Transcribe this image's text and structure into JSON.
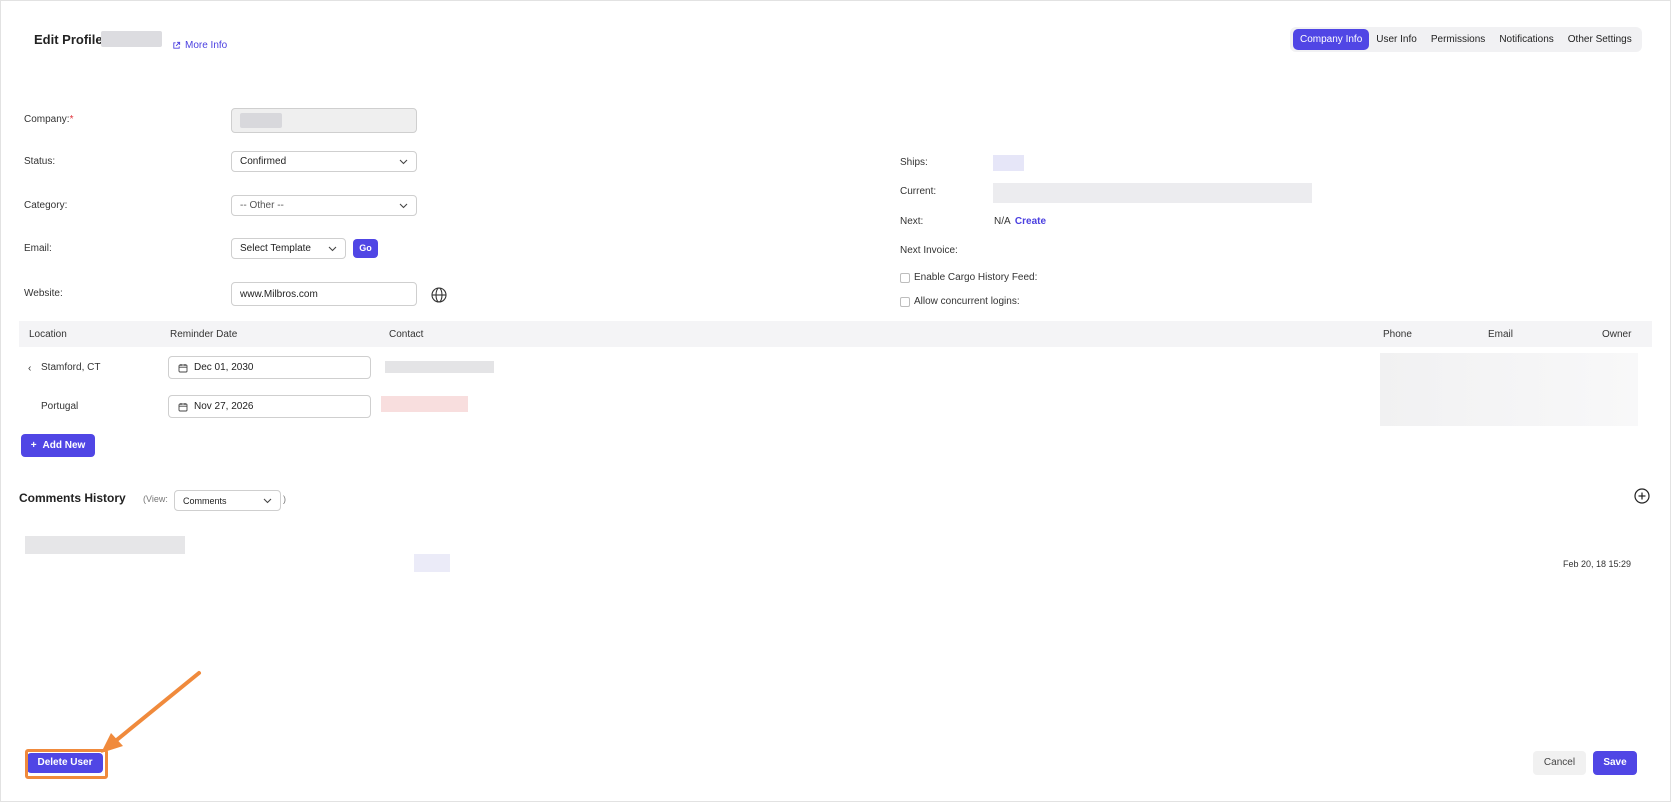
{
  "header": {
    "title": "Edit Profile:",
    "more_info": "More Info",
    "tabs": [
      {
        "label": "Company Info",
        "active": true
      },
      {
        "label": "User Info",
        "active": false
      },
      {
        "label": "Permissions",
        "active": false
      },
      {
        "label": "Notifications",
        "active": false
      },
      {
        "label": "Other Settings",
        "active": false
      }
    ]
  },
  "form_left": {
    "company_label": "Company:",
    "required_mark": "*",
    "status_label": "Status:",
    "status_value": "Confirmed",
    "category_label": "Category:",
    "category_value": "-- Other --",
    "email_label": "Email:",
    "email_template": "Select Template",
    "go_label": "Go",
    "website_label": "Website:",
    "website_value": "www.Milbros.com"
  },
  "form_right": {
    "ships_label": "Ships:",
    "current_label": "Current:",
    "next_label": "Next:",
    "next_value": "N/A",
    "create_link": "Create",
    "next_invoice_label": "Next Invoice:",
    "cargo_feed_label": "Enable Cargo History Feed:",
    "concurrent_label": "Allow concurrent logins:"
  },
  "locations_table": {
    "columns": [
      "Location",
      "Reminder Date",
      "Contact",
      "Phone",
      "Email",
      "Owner"
    ],
    "rows": [
      {
        "location": "Stamford, CT",
        "reminder_date": "Dec 01, 2030",
        "expander": "‹"
      },
      {
        "location": "Portugal",
        "reminder_date": "Nov 27, 2026",
        "expander": ""
      }
    ],
    "add_new": "Add New"
  },
  "comments": {
    "title": "Comments History",
    "view_prefix": "(View:",
    "view_value": "Comments",
    "view_suffix": ")",
    "timestamp": "Feb 20, 18 15:29"
  },
  "footer": {
    "delete_user": "Delete User",
    "cancel": "Cancel",
    "save": "Save"
  },
  "colors": {
    "accent": "#5046e5",
    "annotation": "#f08a3c",
    "required": "#e0313a"
  }
}
